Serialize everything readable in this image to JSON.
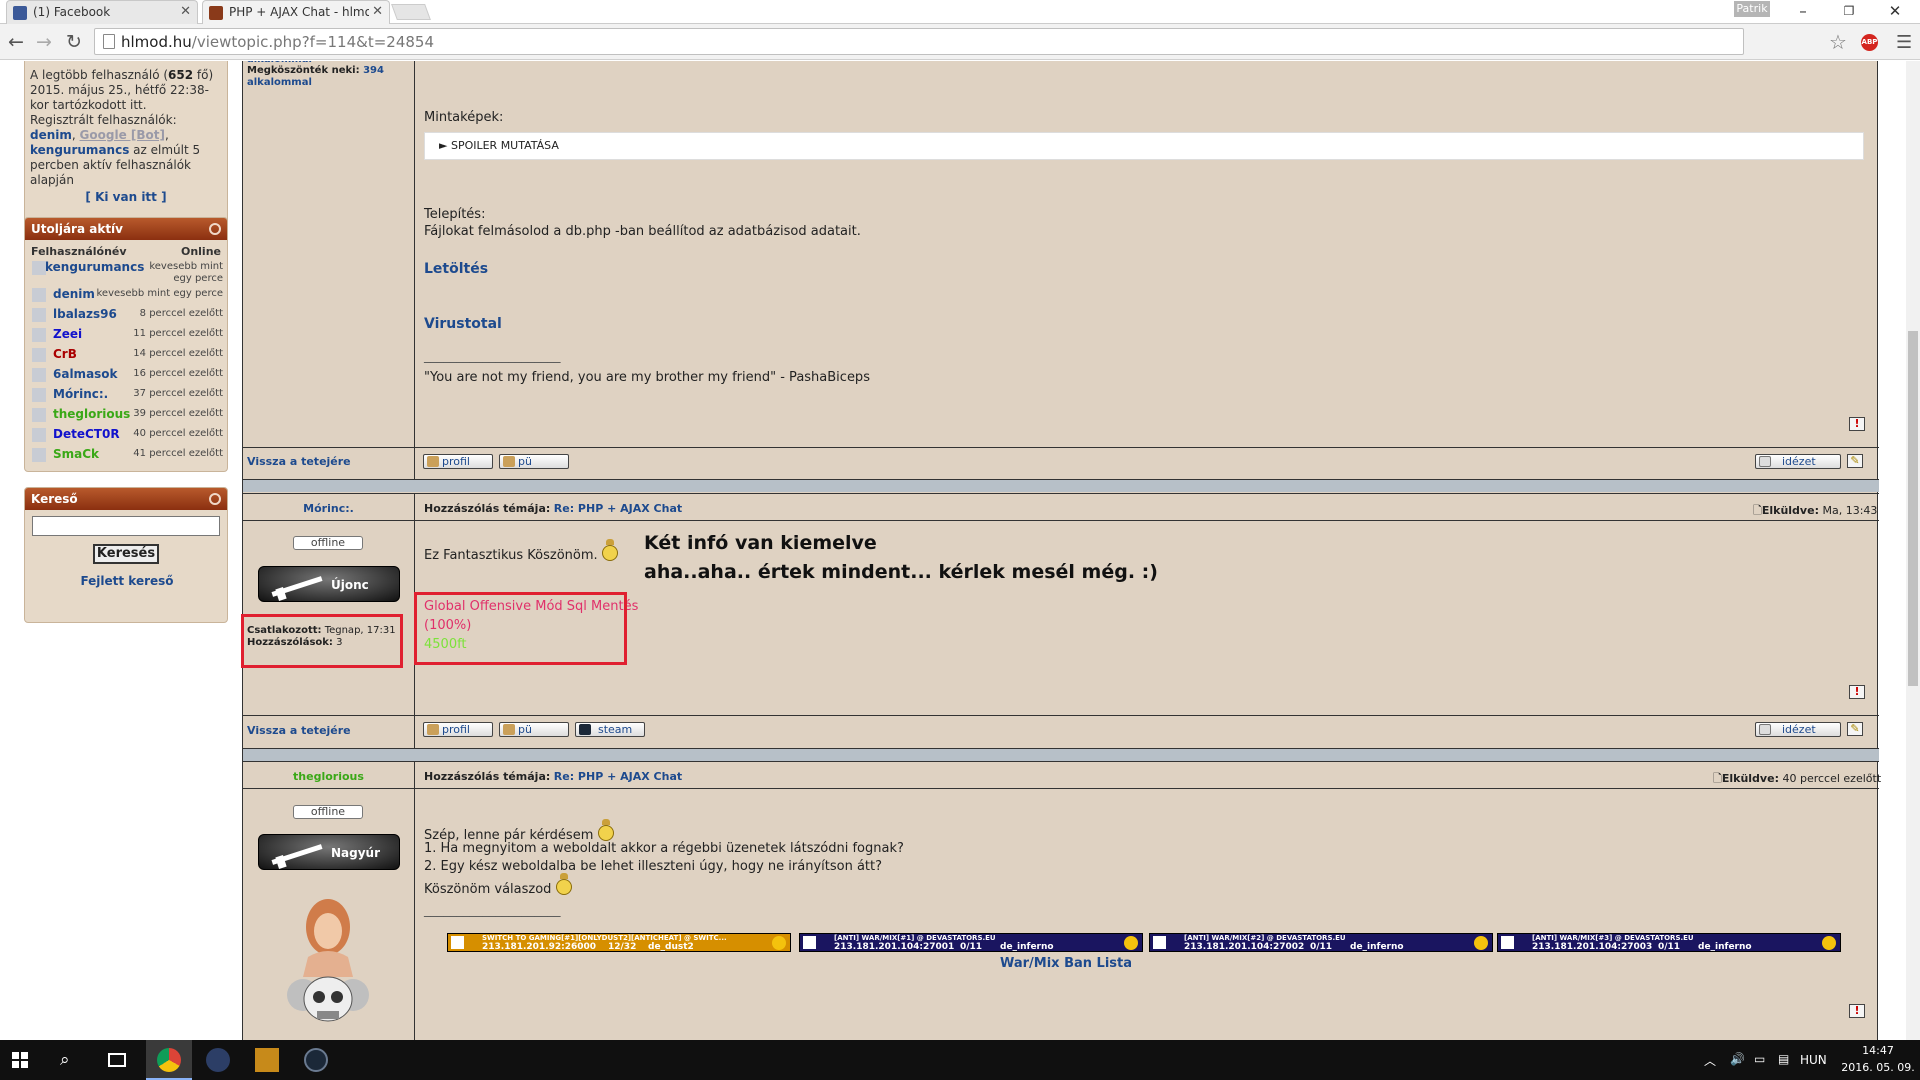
{
  "browser": {
    "tabs": [
      {
        "label": "(1) Facebook",
        "active": false
      },
      {
        "label": "PHP + AJAX Chat - hlmod",
        "active": true
      }
    ],
    "profile": "Patrik",
    "url_host": "hlmod.hu",
    "url_path": "/viewtopic.php?f=114&t=24854",
    "abp": "ABP"
  },
  "sidebar": {
    "stats": {
      "line1_pre": "A legtöbb felhasználó (",
      "line1_num": "652",
      "line1_post": " fő)",
      "line2": "2015. május 25., hétfő 22:38-",
      "line3": "kor tartózkodott itt.",
      "line4": "Regisztrált felhasználók:",
      "user1": "denim",
      "sep1": ", ",
      "user2": "Google [Bot]",
      "sep2": ",",
      "user3": "kengurumancs",
      "line5_post": " az elmúlt 5",
      "line6": "percben aktív felhasználók",
      "line7": "alapján",
      "who": "[ Ki van itt ]"
    },
    "recent": {
      "title": "Utoljára aktív",
      "col_name": "Felhasználónév",
      "col_online": "Online",
      "users": [
        {
          "name": "kengurumancs",
          "time": "kevesebb mint egy perce",
          "color": "#1d4a8e"
        },
        {
          "name": "denim",
          "time": "kevesebb mint egy perce",
          "color": "#1d4a8e"
        },
        {
          "name": "lbalazs96",
          "time": "8 perccel ezelőtt",
          "color": "#1d4a8e"
        },
        {
          "name": "Zeei",
          "time": "11 perccel ezelőtt",
          "color": "#1212cc"
        },
        {
          "name": "CrB",
          "time": "14 perccel ezelőtt",
          "color": "#aa0000"
        },
        {
          "name": "6almasok",
          "time": "16 perccel ezelőtt",
          "color": "#1d4a8e"
        },
        {
          "name": "Mórinc:.",
          "time": "37 perccel ezelőtt",
          "color": "#1d4a8e"
        },
        {
          "name": "theglorious",
          "time": "39 perccel ezelőtt",
          "color": "#3aa817"
        },
        {
          "name": "DeteCT0R",
          "time": "40 perccel ezelőtt",
          "color": "#1212cc"
        },
        {
          "name": "SmaCk",
          "time": "41 perccel ezelőtt",
          "color": "#3aa817"
        }
      ]
    },
    "search": {
      "title": "Kereső",
      "button": "Keresés",
      "advanced": "Fejlett kereső"
    }
  },
  "top_post": {
    "user_frag1": "alkalommal",
    "thanks_label": "Megköszönték neki:",
    "thanks_num": "394",
    "thanks_unit": "alkalommal",
    "samples": "Mintaképek:",
    "spoiler": "► SPOILER MUTATÁSA",
    "install_title": "Telepítés:",
    "install_text": "Fájlokat felmásolod a db.php -ban beállítod az adatbázisod adatait.",
    "download": "Letöltés",
    "virustotal": "Virustotal",
    "sig_line": "_____________________",
    "sig": "\"You are not my friend, you are my brother my friend\" - PashaBiceps",
    "back_top": "Vissza a tetejére",
    "profile": "profil",
    "pm": "pü",
    "quote": "idézet"
  },
  "post2": {
    "user": "Mórinc:.",
    "subject_label": "Hozzászólás témája:",
    "subject": "Re: PHP + AJAX Chat",
    "sent_label": "Elküldve:",
    "sent": "Ma, 13:43",
    "status": "offline",
    "rank": "Újonc",
    "joined_label": "Csatlakozott:",
    "joined": "Tegnap, 17:31",
    "posts_label": "Hozzászólások:",
    "posts": "3",
    "text": "Ez Fantasztikus Köszönöm.",
    "annotation1": "Két infó van kiemelve",
    "annotation2": "aha..aha.. értek mindent... kérlek mesél még. :)",
    "goal_title": "Global Offensive Mód Sql Mentés",
    "goal_pct": "(100%)",
    "goal_amount": "4500ft",
    "back_top": "Vissza a tetejére",
    "profile": "profil",
    "pm": "pü",
    "steam": "steam",
    "quote": "idézet"
  },
  "post3": {
    "user": "theglorious",
    "subject_label": "Hozzászólás témája:",
    "subject": "Re: PHP + AJAX Chat",
    "sent_label": "Elküldve:",
    "sent": "40 perccel ezelőtt",
    "status": "offline",
    "rank": "Nagyúr",
    "line1": "Szép, lenne pár kérdésem",
    "line2": "1. Ha megnyitom a weboldalt akkor a régebbi üzenetek látszódni fognak?",
    "line3": "2. Egy kész weboldalba be lehet illeszteni úgy, hogy ne irányítson átt?",
    "line4": "Köszönöm válaszod",
    "sig_line": "_____________________",
    "servers": [
      {
        "name": "SWITCH TO GAMING[#1][ONLYDUST2][ANTICHEAT] @ SWITC...",
        "addr": "213.181.201.92:26000",
        "players": "12/32",
        "map": "de_dust2"
      },
      {
        "name": "[ANTI] WAR/MIX[#1] @ DEVASTATORS.EU",
        "addr": "213.181.201.104:27001",
        "players": "0/11",
        "map": "de_inferno"
      },
      {
        "name": "[ANTI] WAR/MIX[#2] @ DEVASTATORS.EU",
        "addr": "213.181.201.104:27002",
        "players": "0/11",
        "map": "de_inferno"
      },
      {
        "name": "[ANTI] WAR/MIX[#3] @ DEVASTATORS.EU",
        "addr": "213.181.201.104:27003",
        "players": "0/11",
        "map": "de_inferno"
      }
    ],
    "banlist": "War/Mix Ban Lista"
  },
  "taskbar": {
    "lang": "HUN",
    "time": "14:47",
    "date": "2016. 05. 09."
  }
}
